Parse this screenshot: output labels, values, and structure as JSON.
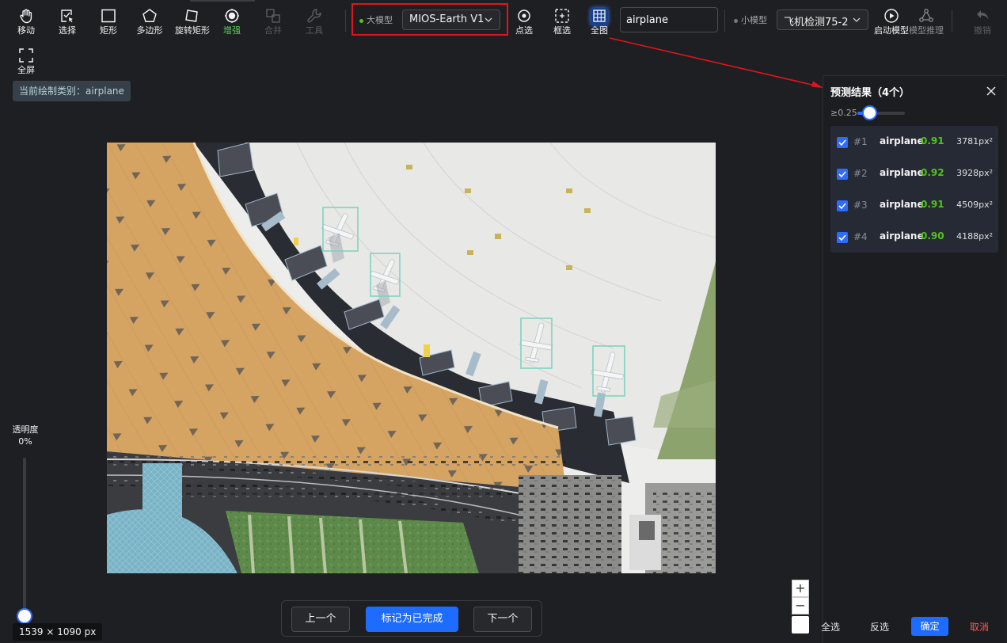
{
  "toolbar": {
    "move": "移动",
    "select": "选择",
    "rect": "矩形",
    "polygon": "多边形",
    "rotated_rect": "旋转矩形",
    "enhance": "增强",
    "merge": "合并",
    "tools": "工具",
    "fullscreen": "全屏",
    "large_model_label": "大模型",
    "large_model_value": "MIOS-Earth V1",
    "point_select": "点选",
    "box_select": "框选",
    "full_image": "全图",
    "class_input_value": "airplane",
    "small_model_label": "小模型",
    "small_model_value": "飞机检测75-2",
    "start_model": "启动模型",
    "model_infer": "模型推理",
    "undo": "撤销"
  },
  "category_badge": "当前绘制类别：airplane",
  "opacity": {
    "label": "透明度",
    "value": "0%"
  },
  "image_size": "1539 × 1090 px",
  "navigation": {
    "prev": "上一个",
    "mark_done": "标记为已完成",
    "next": "下一个"
  },
  "zoom": {
    "in": "+",
    "out": "−"
  },
  "results_panel": {
    "title": "预测结果（4个）",
    "threshold_label": "≥0.25",
    "threshold_value": 0.25,
    "items": [
      {
        "id": "#1",
        "label": "airplane",
        "score": "0.91",
        "area": "3781px²"
      },
      {
        "id": "#2",
        "label": "airplane",
        "score": "0.92",
        "area": "3928px²"
      },
      {
        "id": "#3",
        "label": "airplane",
        "score": "0.91",
        "area": "4509px²"
      },
      {
        "id": "#4",
        "label": "airplane",
        "score": "0.90",
        "area": "4188px²"
      }
    ],
    "select_all": "全选",
    "invert": "反选",
    "confirm": "确定",
    "cancel": "取消"
  },
  "colors": {
    "accent": "#1e6bff",
    "score_green": "#52c41a",
    "highlight_red": "#e0141a",
    "detection_box": "#7fd3c0"
  }
}
